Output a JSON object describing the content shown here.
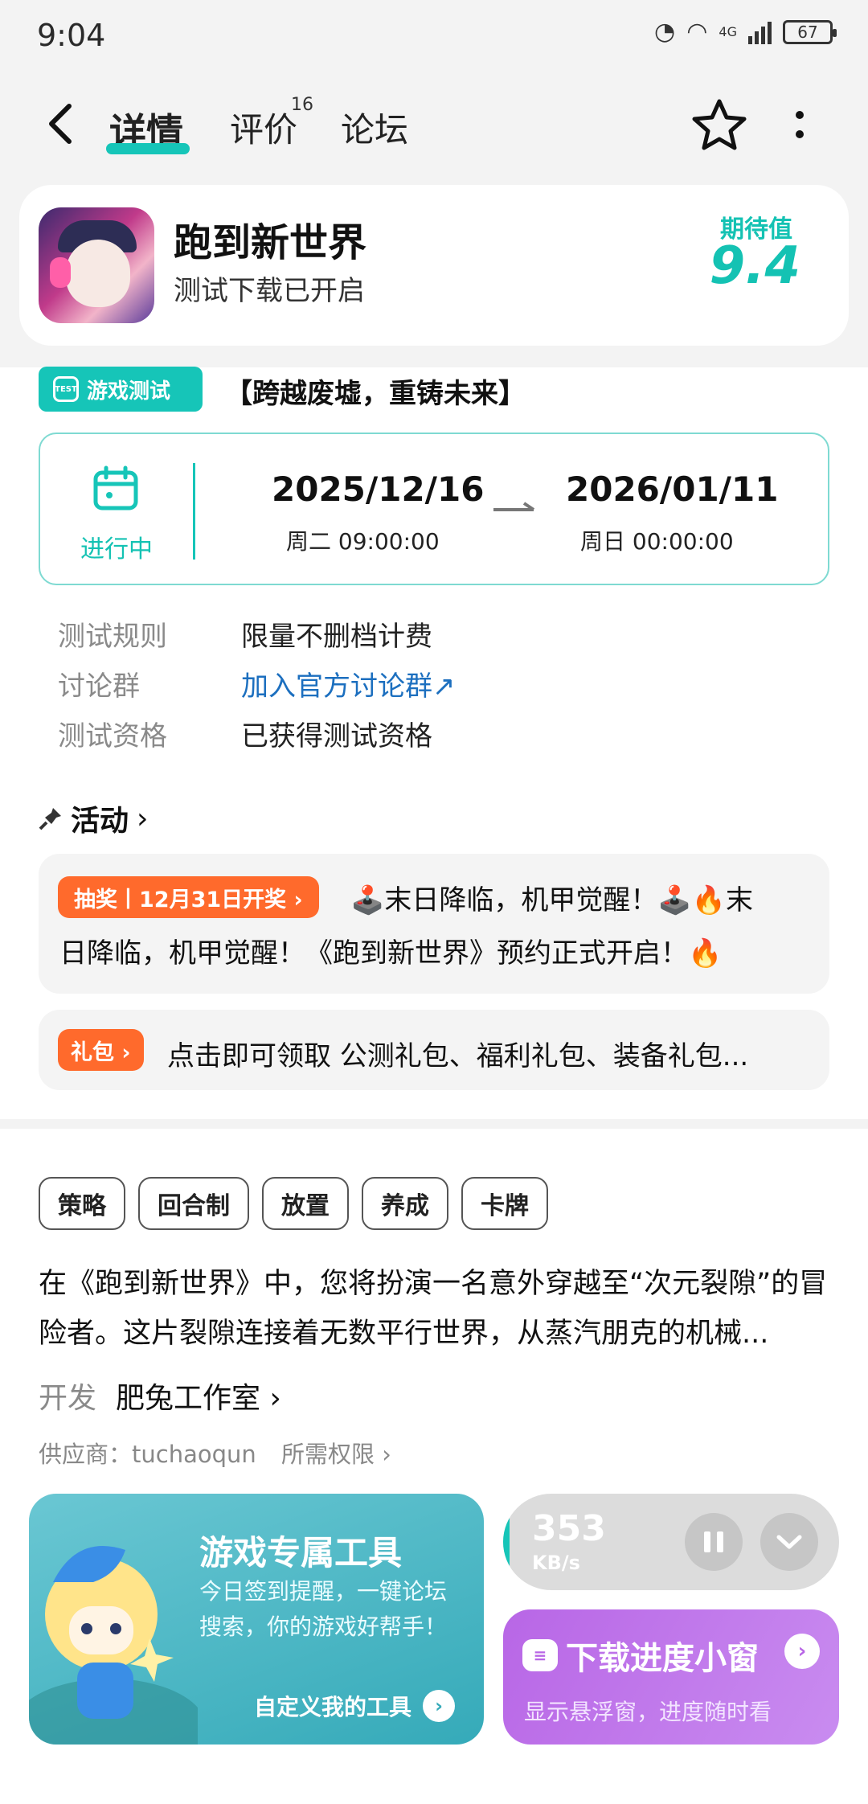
{
  "status_bar": {
    "time": "9:04",
    "network": "4G",
    "battery": "67"
  },
  "header": {
    "tabs": [
      {
        "label": "详情"
      },
      {
        "label": "评价",
        "badge": "16"
      },
      {
        "label": "论坛"
      }
    ]
  },
  "app": {
    "name": "跑到新世界",
    "subtitle": "测试下载已开启",
    "expect_label": "期待值",
    "expect_value": "9.4"
  },
  "test": {
    "badge": "游戏测试",
    "title": "【跨越废墟，重铸未来】",
    "status": "进行中",
    "start_date": "2025/12/16",
    "start_time": "周二  09:00:00",
    "end_date": "2026/01/11",
    "end_time": "周日  00:00:00",
    "rows": [
      {
        "key": "测试规则",
        "value": "限量不删档计费"
      },
      {
        "key": "讨论群",
        "value": "加入官方讨论群↗"
      },
      {
        "key": "测试资格",
        "value": "已获得测试资格"
      }
    ]
  },
  "activity": {
    "title": "活动",
    "lottery_badge": "抽奖丨12月31日开奖 ›",
    "lottery_text_1": "🕹️末日降临，机甲觉醒！🕹️🔥末",
    "lottery_text_2": "日降临，机甲觉醒！《跑到新世界》预约正式开启！🔥",
    "gift_badge": "礼包 ›",
    "gift_text": "点击即可领取 公测礼包、福利礼包、装备礼包..."
  },
  "tags": [
    "策略",
    "回合制",
    "放置",
    "养成",
    "卡牌"
  ],
  "description": "在《跑到新世界》中，您将扮演一名意外穿越至“次元裂隙”的冒险者。这片裂隙连接着无数平行世界，从蒸汽朋克的机械...",
  "developer": {
    "label": "开发",
    "name": "肥兔工作室 ›"
  },
  "supplier": "供应商：tuchaoqun",
  "permissions": "所需权限 ›",
  "tool_card": {
    "title": "游戏专属工具",
    "desc": "今日签到提醒，一键论坛搜索，你的游戏好帮手！",
    "link": "自定义我的工具"
  },
  "download": {
    "speed": "353",
    "unit": "KB/s"
  },
  "float_window": {
    "title": "下载进度小窗",
    "subtitle": "显示悬浮窗，进度随时看"
  },
  "colors": {
    "accent": "#16c5b8",
    "orange": "#ff6a2c",
    "purple": "#b866e6",
    "link": "#1c6fbf"
  }
}
